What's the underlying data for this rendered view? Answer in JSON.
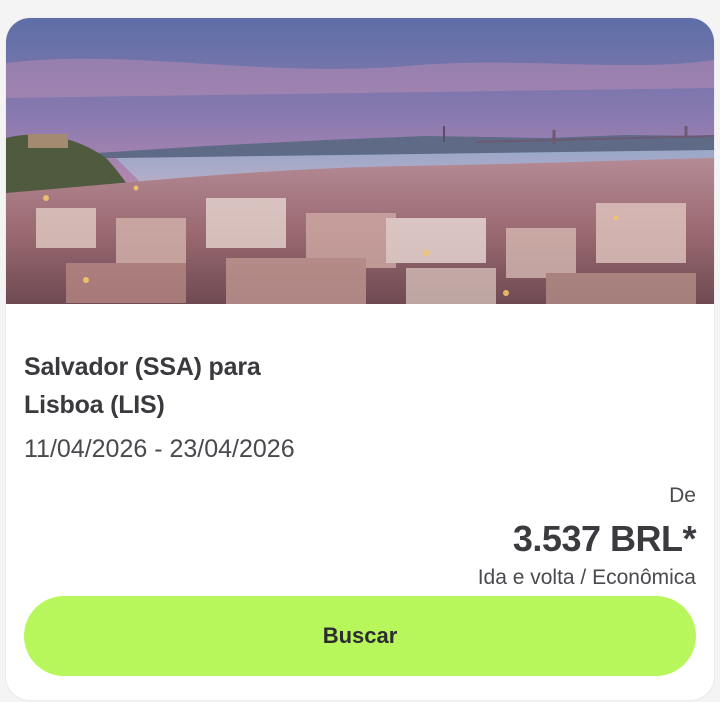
{
  "card": {
    "image_alt_subject": "Lisbon city view at dusk",
    "route": {
      "line1": "Salvador (SSA) para",
      "line2": "Lisboa (LIS)"
    },
    "dates": "11/04/2026 - 23/04/2026",
    "price_prefix": "De",
    "price": "3.537 BRL*",
    "fare_type": "Ida e volta / Econômica",
    "cta_label": "Buscar"
  },
  "colors": {
    "cta_background": "#b7f75c",
    "card_background": "#ffffff",
    "text_primary": "#3b3b3f"
  }
}
